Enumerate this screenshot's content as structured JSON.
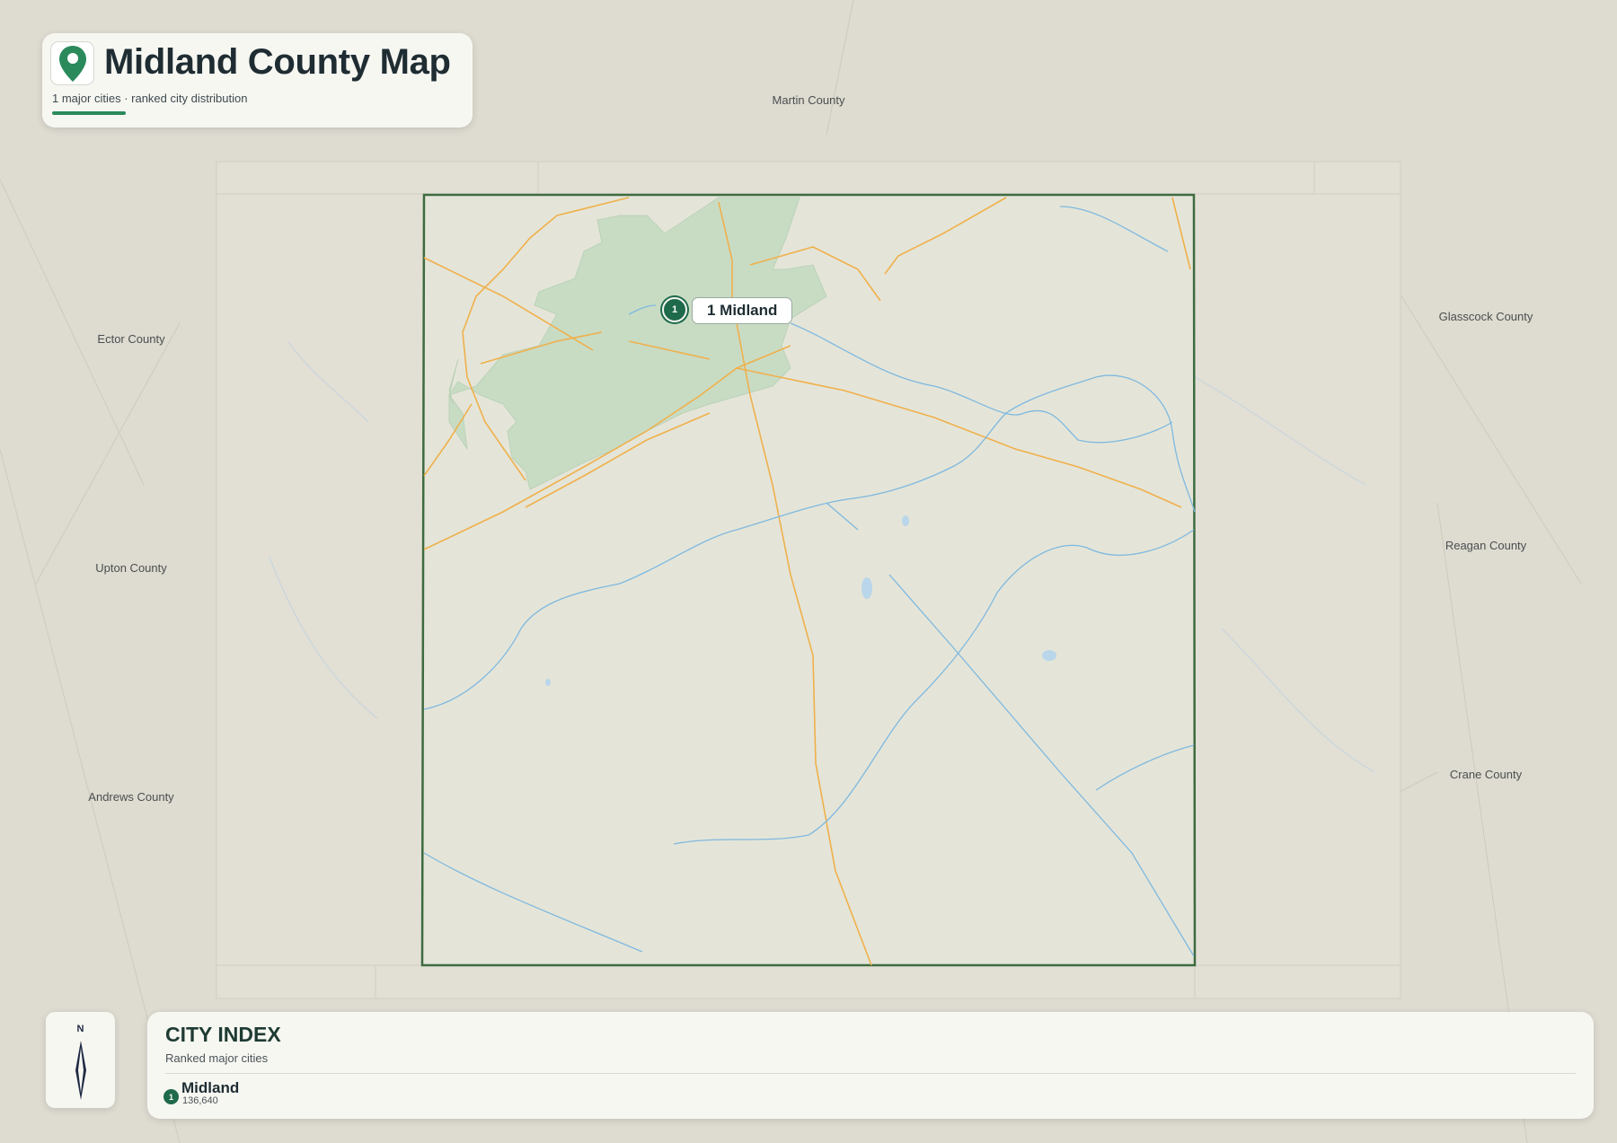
{
  "header": {
    "title": "Midland County Map",
    "subtitle": "1 major cities · ranked city distribution",
    "icon": "map-pin-icon",
    "accent_color": "#2a8a5c"
  },
  "map": {
    "county_boundary_color": "#3d6b3f",
    "road_color": "#f0b04c",
    "water_color": "#7fb8e0",
    "urban_color": "#c8dcc4"
  },
  "neighbors": [
    {
      "name": "Martin County"
    },
    {
      "name": "Ector County"
    },
    {
      "name": "Glasscock County"
    },
    {
      "name": "Upton County"
    },
    {
      "name": "Reagan County"
    },
    {
      "name": "Andrews County"
    },
    {
      "name": "Crane County"
    }
  ],
  "cities": [
    {
      "rank": "1",
      "name": "Midland",
      "label": "1 Midland",
      "population": "136,640"
    }
  ],
  "compass": {
    "north_label": "N",
    "icon": "compass-icon"
  },
  "index": {
    "title": "CITY INDEX",
    "subtitle": "Ranked major cities"
  }
}
